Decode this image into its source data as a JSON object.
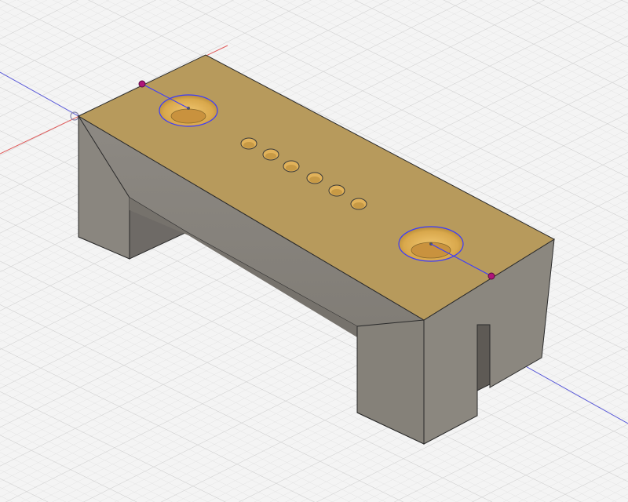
{
  "viewport": {
    "background": "#f4f4f4",
    "grid_minor_color": "#e0e0e0",
    "grid_major_color": "#cdcdcd",
    "x_axis_color": "#e05a5a",
    "y_axis_color": "#5a5ad8"
  },
  "model": {
    "top_face_color": "#b79a5c",
    "front_face_color": "#84807a",
    "left_face_color": "#8e8a84",
    "cavity_color": "#6e6a66",
    "edge_color": "#2a2a2a",
    "countersink_color": "#d9a84c",
    "small_hole_count": 6,
    "large_hole_count": 2
  },
  "sketch": {
    "line_color": "#3a3aff",
    "endpoint_color": "#b0157a"
  }
}
